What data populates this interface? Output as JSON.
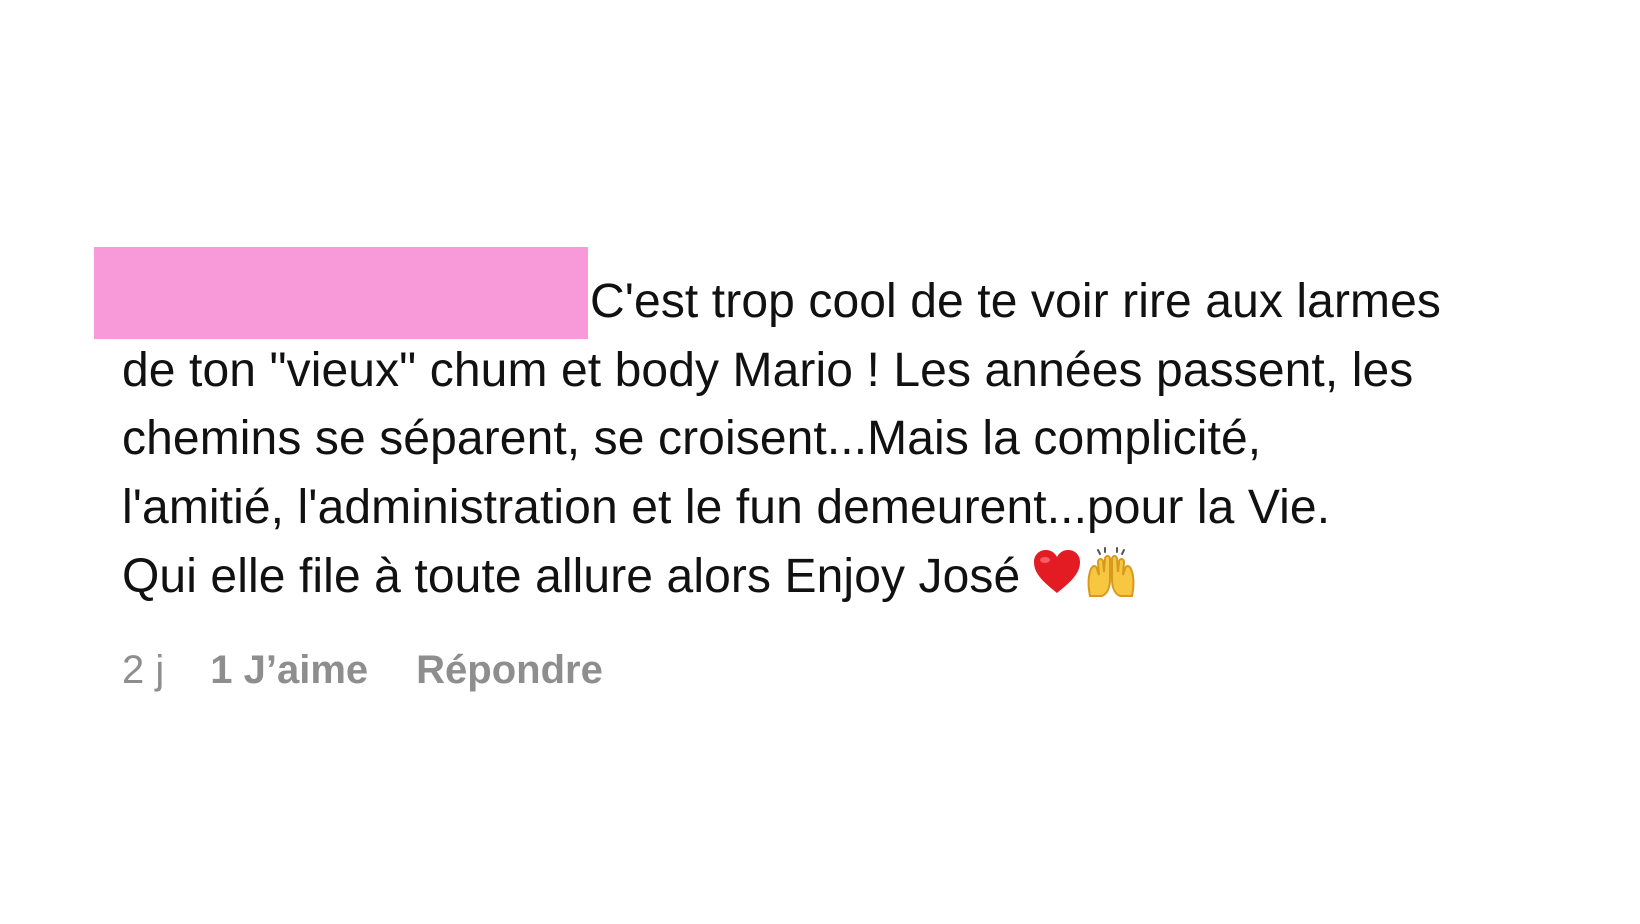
{
  "comment": {
    "lines": [
      "C'est trop cool de te voir rire aux larmes",
      "de ton \"vieux\" chum et body Mario ! Les années passent, les",
      "chemins se séparent, se croisent...Mais la complicité,",
      "l'amitié, l'administration et le fun demeurent...pour la Vie.",
      "Qui elle file à toute allure alors Enjoy José"
    ],
    "emojis": [
      "heart-icon",
      "raising-hands-icon"
    ],
    "redaction_color": "#f89ad9"
  },
  "actions": {
    "time": "2 j",
    "likes": "1 J’aime",
    "reply": "Répondre"
  }
}
